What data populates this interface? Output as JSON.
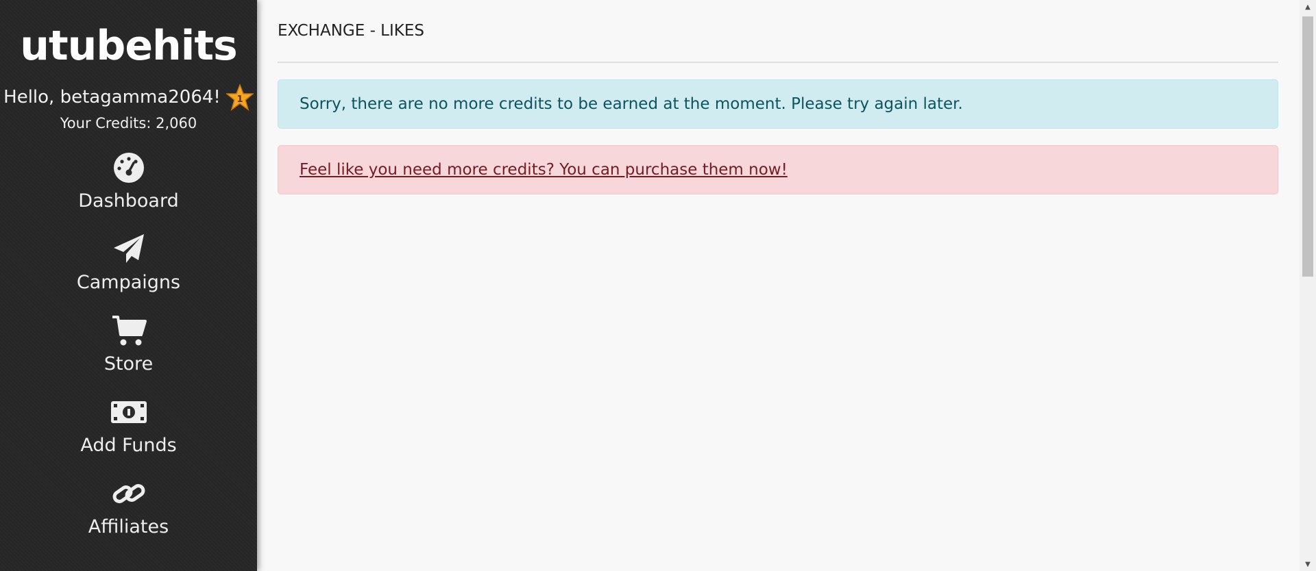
{
  "sidebar": {
    "logo_text": "utubehits",
    "greeting": "Hello, betagamma2064!",
    "rank_badge": "1",
    "credits_text": "Your Credits: 2,060",
    "nav": [
      {
        "label": "Dashboard",
        "icon": "dashboard-icon"
      },
      {
        "label": "Campaigns",
        "icon": "paper-plane-icon"
      },
      {
        "label": "Store",
        "icon": "cart-icon"
      },
      {
        "label": "Add Funds",
        "icon": "money-bill-icon"
      },
      {
        "label": "Affiliates",
        "icon": "link-icon"
      }
    ]
  },
  "main": {
    "title": "EXCHANGE - LIKES",
    "info_message": "Sorry, there are no more credits to be earned at the moment. Please try again later.",
    "purchase_link": "Feel like you need more credits? You can purchase them now!"
  },
  "colors": {
    "info_bg": "#d1ecf1",
    "danger_bg": "#f8d7da",
    "sidebar_bg": "#2a2a2a"
  }
}
